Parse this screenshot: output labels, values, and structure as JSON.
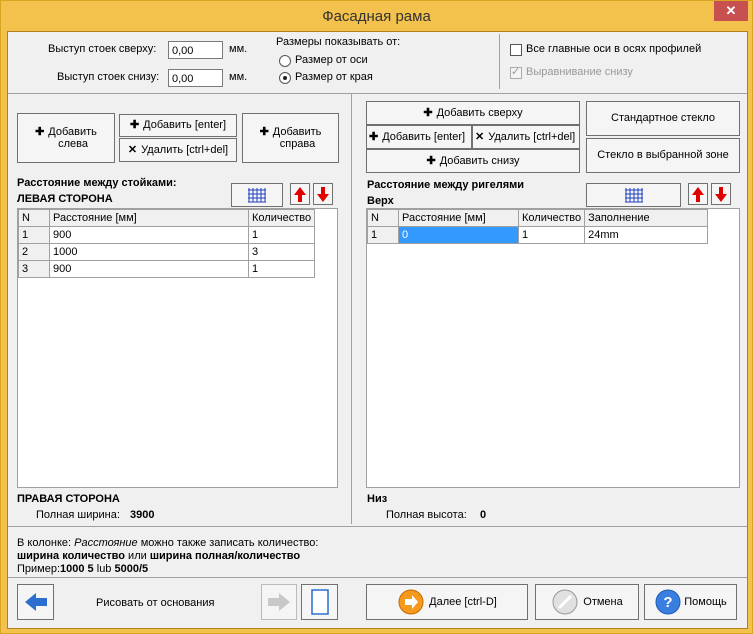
{
  "window": {
    "title": "Фасадная рама",
    "close": "✕"
  },
  "top": {
    "offset_top_label": "Выступ стоек сверху:",
    "offset_top_value": "0,00",
    "offset_bottom_label": "Выступ стоек снизу:",
    "offset_bottom_value": "0,00",
    "unit": "мм.",
    "sizes_label": "Размеры показывать от:",
    "radio_axis": "Размер от оси",
    "radio_edge": "Размер от края",
    "chk_axes": "Все главные оси в осях профилей",
    "chk_align": "Выравнивание снизу"
  },
  "left": {
    "add_left": [
      "Добавить",
      "слева"
    ],
    "add_enter": "Добавить [enter]",
    "delete": "Удалить [ctrl+del]",
    "add_right": [
      "Добавить",
      "справа"
    ],
    "title": "Расстояние между стойками:",
    "side_top": "ЛЕВАЯ СТОРОНА",
    "side_bottom": "ПРАВАЯ СТОРОНА",
    "total_label": "Полная ширина:",
    "total_value": "3900",
    "headers": [
      "N",
      "Расстояние [мм]",
      "Количество"
    ],
    "rows": [
      [
        "1",
        "900",
        "1"
      ],
      [
        "2",
        "1000",
        "3"
      ],
      [
        "3",
        "900",
        "1"
      ]
    ]
  },
  "right": {
    "add_top": "Добавить сверху",
    "add_enter": "Добавить [enter]",
    "delete": "Удалить [ctrl+del]",
    "add_bottom": "Добавить снизу",
    "std_glass": "Стандартное стекло",
    "zone_glass": "Стекло в выбранной зоне",
    "title": "Расстояние между ригелями",
    "side_top": "Верх",
    "side_bottom": "Низ",
    "total_label": "Полная высота:",
    "total_value": "0",
    "headers": [
      "N",
      "Расстояние [мм]",
      "Количество",
      "Заполнение"
    ],
    "rows": [
      [
        "1",
        "0",
        "1",
        "24mm"
      ]
    ]
  },
  "hint": {
    "line1_a": "В колонке: ",
    "line1_b": "Расстояние",
    "line1_c": " можно также записать количество:",
    "line2_a": "ширина количество",
    "line2_b": " или ",
    "line2_c": "ширина полная/количество",
    "line3_a": "Пример:",
    "line3_b": "1000 5",
    "line3_c": "  lub ",
    "line3_d": "5000/5"
  },
  "bottom": {
    "draw_base": "Рисовать от основания",
    "next": "Далее [ctrl-D]",
    "cancel": "Отмена",
    "help": "Помощь"
  },
  "colors": {
    "accent": "#3399ff",
    "title_bar": "#f3c24c",
    "close": "#c75050"
  }
}
